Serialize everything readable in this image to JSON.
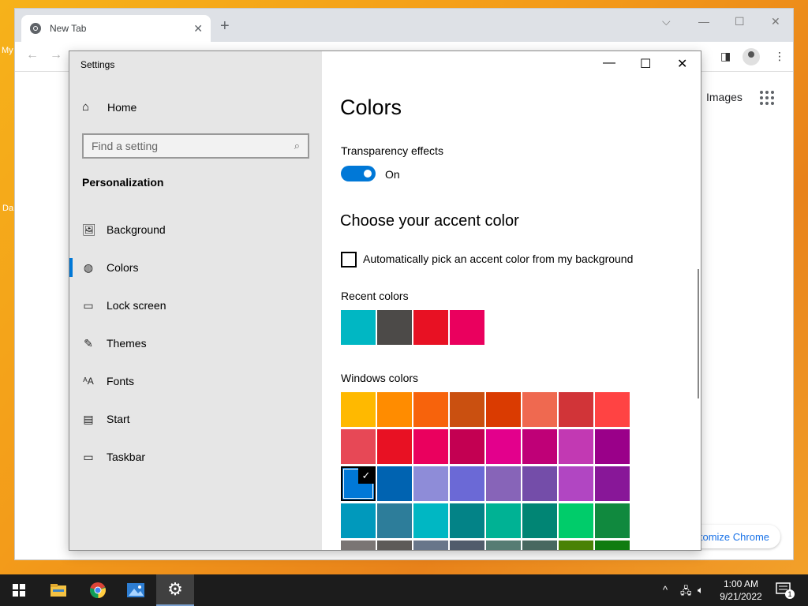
{
  "desktop": {
    "left_texts": [
      "My",
      "Da"
    ]
  },
  "chrome": {
    "tab_title": "New Tab",
    "tab_close": "✕",
    "new_tab": "+",
    "controls": {
      "dropdown": "⌵",
      "minimize": "—",
      "maximize": "☐",
      "close": "✕"
    },
    "back": "←",
    "forward": "→",
    "images_link": "Images",
    "customize_button": "tomize Chrome"
  },
  "settings": {
    "window_title": "Settings",
    "window_controls": {
      "minimize": "—",
      "maximize": "☐",
      "close": "✕"
    },
    "home_label": "Home",
    "search_placeholder": "Find a setting",
    "section_title": "Personalization",
    "nav_items": [
      {
        "label": "Background",
        "icon": "image-icon",
        "glyph": "▭"
      },
      {
        "label": "Colors",
        "icon": "palette-icon",
        "glyph": "◍"
      },
      {
        "label": "Lock screen",
        "icon": "lock-screen-icon",
        "glyph": "▭"
      },
      {
        "label": "Themes",
        "icon": "brush-icon",
        "glyph": "✎"
      },
      {
        "label": "Fonts",
        "icon": "font-icon",
        "glyph": "A"
      },
      {
        "label": "Start",
        "icon": "start-icon",
        "glyph": "▤"
      },
      {
        "label": "Taskbar",
        "icon": "taskbar-icon",
        "glyph": "▭"
      }
    ],
    "active_nav": "Colors",
    "page_title": "Colors",
    "transparency_label": "Transparency effects",
    "transparency_state": "On",
    "accent_heading": "Choose your accent color",
    "auto_pick_label": "Automatically pick an accent color from my background",
    "auto_pick_checked": false,
    "recent_colors_label": "Recent colors",
    "recent_colors": [
      "#00b7c3",
      "#4c4a48",
      "#e81123",
      "#ea005e"
    ],
    "windows_colors_label": "Windows colors",
    "windows_colors": [
      [
        "#ffb900",
        "#ff8c00",
        "#f7630c",
        "#ca5010",
        "#da3b01",
        "#ef6950",
        "#d13438",
        "#ff4343"
      ],
      [
        "#e74856",
        "#e81123",
        "#ea005e",
        "#c30052",
        "#e3008c",
        "#bf0077",
        "#c239b3",
        "#9a0089"
      ],
      [
        "#0078d7",
        "#0063b1",
        "#8e8cd8",
        "#6b69d6",
        "#8764b8",
        "#744da9",
        "#b146c2",
        "#881798"
      ],
      [
        "#0099bc",
        "#2d7d9a",
        "#00b7c3",
        "#038387",
        "#00b294",
        "#018574",
        "#00cc6a",
        "#10893e"
      ],
      [
        "#7a7574",
        "#5d5a58",
        "#68768a",
        "#515c6b",
        "#567c73",
        "#486860",
        "#498205",
        "#107c10"
      ]
    ],
    "selected_color": "#0078d7",
    "selected_mark": "✓"
  },
  "taskbar": {
    "apps": [
      "start-button",
      "file-explorer",
      "chrome",
      "photos",
      "settings"
    ],
    "tray_chevron": "^",
    "time": "1:00 AM",
    "date": "9/21/2022",
    "notification_count": "1"
  }
}
